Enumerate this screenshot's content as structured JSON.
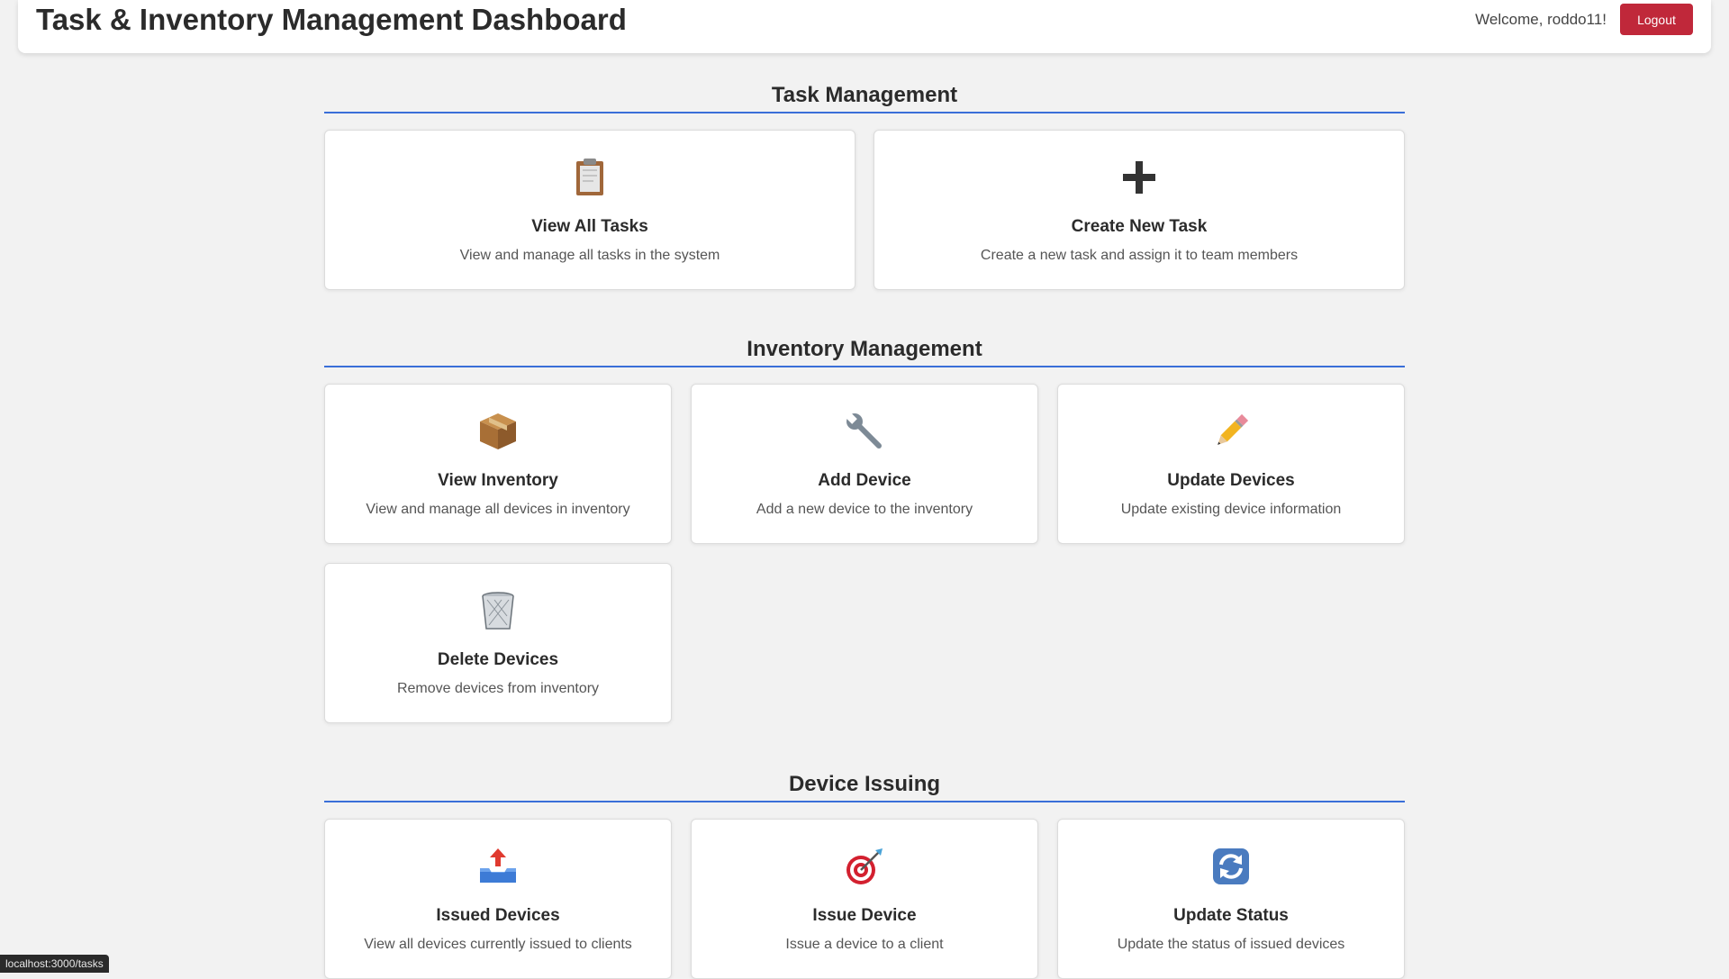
{
  "header": {
    "title": "Task & Inventory Management Dashboard",
    "welcome": "Welcome, roddo11!",
    "logout_label": "Logout",
    "logout_color": "#c0283a"
  },
  "accent_color": "#3a6fd8",
  "task_section": {
    "title": "Task Management",
    "cards": [
      {
        "icon": "clipboard-icon",
        "title": "View All Tasks",
        "desc": "View and manage all tasks in the system"
      },
      {
        "icon": "plus-icon",
        "title": "Create New Task",
        "desc": "Create a new task and assign it to team members"
      }
    ]
  },
  "inventory_section": {
    "title": "Inventory Management",
    "cards": [
      {
        "icon": "package-icon",
        "title": "View Inventory",
        "desc": "View and manage all devices in inventory"
      },
      {
        "icon": "wrench-icon",
        "title": "Add Device",
        "desc": "Add a new device to the inventory"
      },
      {
        "icon": "pencil-icon",
        "title": "Update Devices",
        "desc": "Update existing device information"
      },
      {
        "icon": "wastebasket-icon",
        "title": "Delete Devices",
        "desc": "Remove devices from inventory"
      }
    ]
  },
  "issuing_section": {
    "title": "Device Issuing",
    "cards": [
      {
        "icon": "outbox-tray-icon",
        "title": "Issued Devices",
        "desc": "View all devices currently issued to clients"
      },
      {
        "icon": "target-icon",
        "title": "Issue Device",
        "desc": "Issue a device to a client"
      },
      {
        "icon": "refresh-icon",
        "title": "Update Status",
        "desc": "Update the status of issued devices"
      }
    ]
  },
  "statusbar": {
    "url": "localhost:3000/tasks"
  }
}
